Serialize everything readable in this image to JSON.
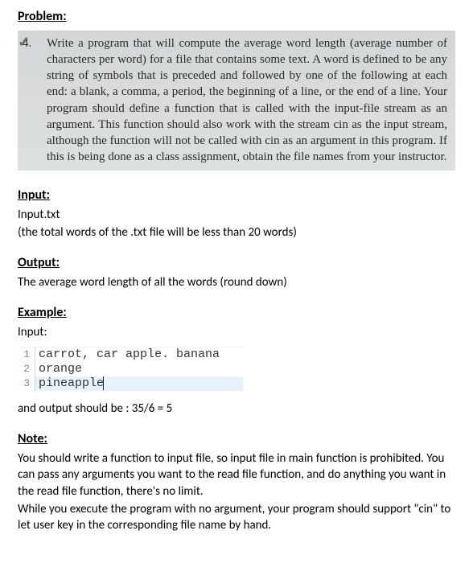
{
  "headings": {
    "problem": "Problem:",
    "input": "Input:",
    "output": "Output:",
    "example": "Example:",
    "note": "Note:"
  },
  "textbook": {
    "number": "4.",
    "text": "Write a program that will compute the average word length (average number of characters per word) for a file that contains some text. A word is defined to be any string of symbols that is preceded and followed by one of the following at each end: a blank, a comma, a period, the beginning of a line, or the end of a line. Your program should define a function that is called with the input-file stream as an argument. This function should also work with the stream cin as the input stream, although the function will not be called with cin as an argument in this program. If this is being done as a class assignment, obtain the file names from your instructor."
  },
  "input_section": {
    "line1": "Input.txt",
    "line2": "(the total words of the .txt file will be less than 20 words)"
  },
  "output_section": {
    "line1": "The average word length of all the words (round down)"
  },
  "example_section": {
    "label": "Input:",
    "lines": [
      {
        "n": "1",
        "code": "carrot, car apple. banana",
        "highlight": false
      },
      {
        "n": "2",
        "code": "orange",
        "highlight": false
      },
      {
        "n": "3",
        "code": "pineapple",
        "highlight": true
      }
    ],
    "result": "and output should be : 35/6 = 5"
  },
  "note_section": {
    "p1": "You should write a function to input file, so input file in main function is prohibited. You can pass any arguments you want to the read file function, and do anything you want in the read file function, there's no limit.",
    "p2": "While you execute the program with no argument, your program should support \"cin\" to let user key in the corresponding file name by hand."
  }
}
